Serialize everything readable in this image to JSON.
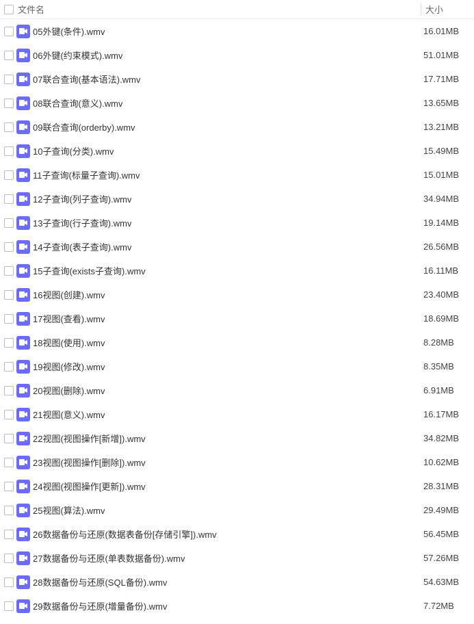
{
  "header": {
    "name_label": "文件名",
    "size_label": "大小"
  },
  "files": [
    {
      "name": "05外键(条件).wmv",
      "size": "16.01MB"
    },
    {
      "name": "06外键(约束模式).wmv",
      "size": "51.01MB"
    },
    {
      "name": "07联合查询(基本语法).wmv",
      "size": "17.71MB"
    },
    {
      "name": "08联合查询(意义).wmv",
      "size": "13.65MB"
    },
    {
      "name": "09联合查询(orderby).wmv",
      "size": "13.21MB"
    },
    {
      "name": "10子查询(分类).wmv",
      "size": "15.49MB"
    },
    {
      "name": "11子查询(标量子查询).wmv",
      "size": "15.01MB"
    },
    {
      "name": "12子查询(列子查询).wmv",
      "size": "34.94MB"
    },
    {
      "name": "13子查询(行子查询).wmv",
      "size": "19.14MB"
    },
    {
      "name": "14子查询(表子查询).wmv",
      "size": "26.56MB"
    },
    {
      "name": "15子查询(exists子查询).wmv",
      "size": "16.11MB"
    },
    {
      "name": "16视图(创建).wmv",
      "size": "23.40MB"
    },
    {
      "name": "17视图(查看).wmv",
      "size": "18.69MB"
    },
    {
      "name": "18视图(使用).wmv",
      "size": "8.28MB"
    },
    {
      "name": "19视图(修改).wmv",
      "size": "8.35MB"
    },
    {
      "name": "20视图(删除).wmv",
      "size": "6.91MB"
    },
    {
      "name": "21视图(意义).wmv",
      "size": "16.17MB"
    },
    {
      "name": "22视图(视图操作[新增]).wmv",
      "size": "34.82MB"
    },
    {
      "name": "23视图(视图操作[删除]).wmv",
      "size": "10.62MB"
    },
    {
      "name": "24视图(视图操作[更新]).wmv",
      "size": "28.31MB"
    },
    {
      "name": "25视图(算法).wmv",
      "size": "29.49MB"
    },
    {
      "name": "26数据备份与还原(数据表备份[存储引擎]).wmv",
      "size": "56.45MB"
    },
    {
      "name": "27数据备份与还原(单表数据备份).wmv",
      "size": "57.26MB"
    },
    {
      "name": "28数据备份与还原(SQL备份).wmv",
      "size": "54.63MB"
    },
    {
      "name": "29数据备份与还原(增量备份).wmv",
      "size": "7.72MB"
    }
  ]
}
